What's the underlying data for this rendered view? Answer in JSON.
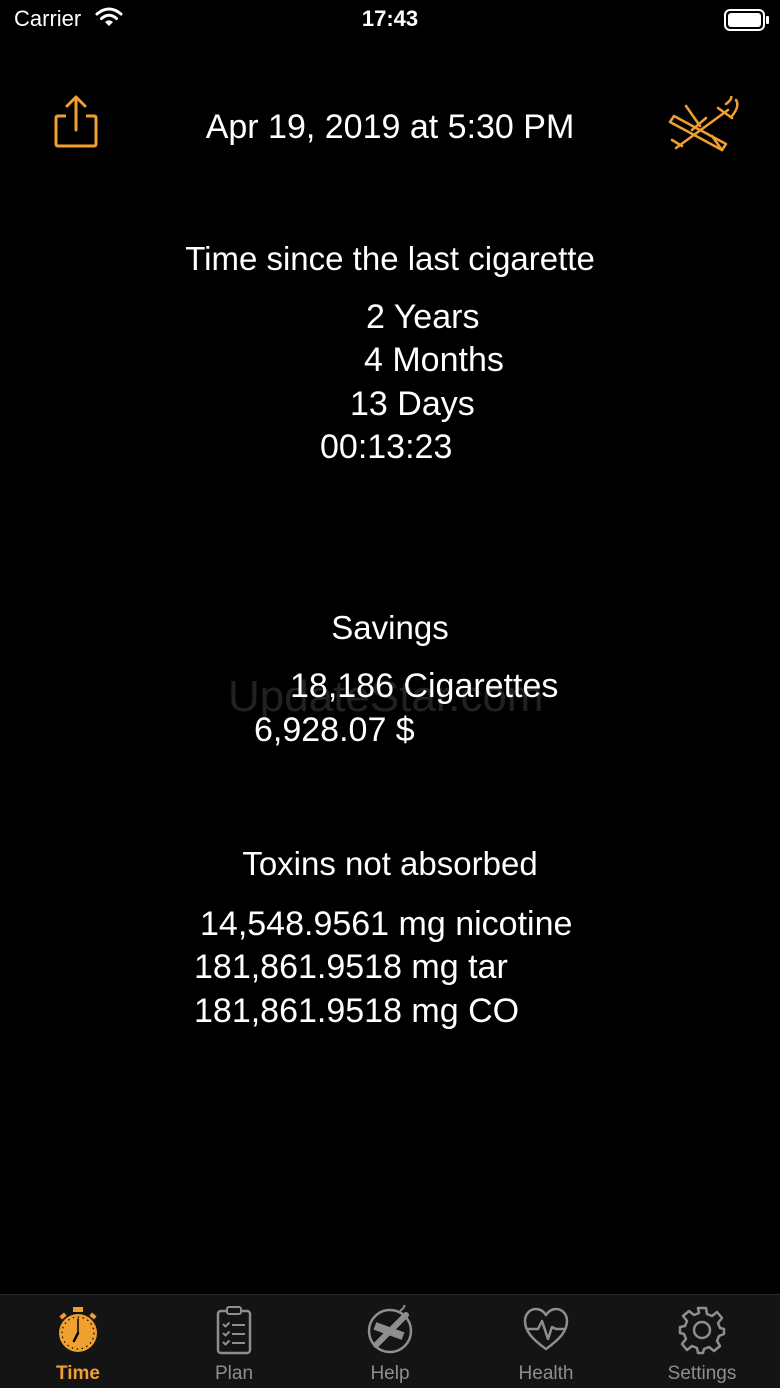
{
  "status_bar": {
    "carrier": "Carrier",
    "time": "17:43"
  },
  "header": {
    "quit_date": "Apr 19, 2019 at 5:30 PM",
    "share_icon": "share-icon",
    "nosmoke_icon": "no-smoking-icon"
  },
  "time_section": {
    "title": "Time since the last cigarette",
    "years": "2 Years",
    "months": "4 Months",
    "days": "13 Days",
    "clock": "00:13:23"
  },
  "savings_section": {
    "title": "Savings",
    "cigarettes": "18,186 Cigarettes",
    "money": "6,928.07 $"
  },
  "toxins_section": {
    "title": "Toxins not absorbed",
    "nicotine": "14,548.9561 mg nicotine",
    "tar": "181,861.9518 mg tar",
    "co": "181,861.9518 mg CO"
  },
  "watermark": "UpdateStar.com",
  "tab_bar": {
    "items": [
      {
        "label": "Time",
        "icon": "stopwatch-icon",
        "active": true
      },
      {
        "label": "Plan",
        "icon": "clipboard-icon",
        "active": false
      },
      {
        "label": "Help",
        "icon": "no-smoking-icon",
        "active": false
      },
      {
        "label": "Health",
        "icon": "heart-pulse-icon",
        "active": false
      },
      {
        "label": "Settings",
        "icon": "gear-icon",
        "active": false
      }
    ]
  },
  "colors": {
    "accent": "#f0a030",
    "background": "#000000",
    "inactive_tab": "#8e8e8e"
  }
}
